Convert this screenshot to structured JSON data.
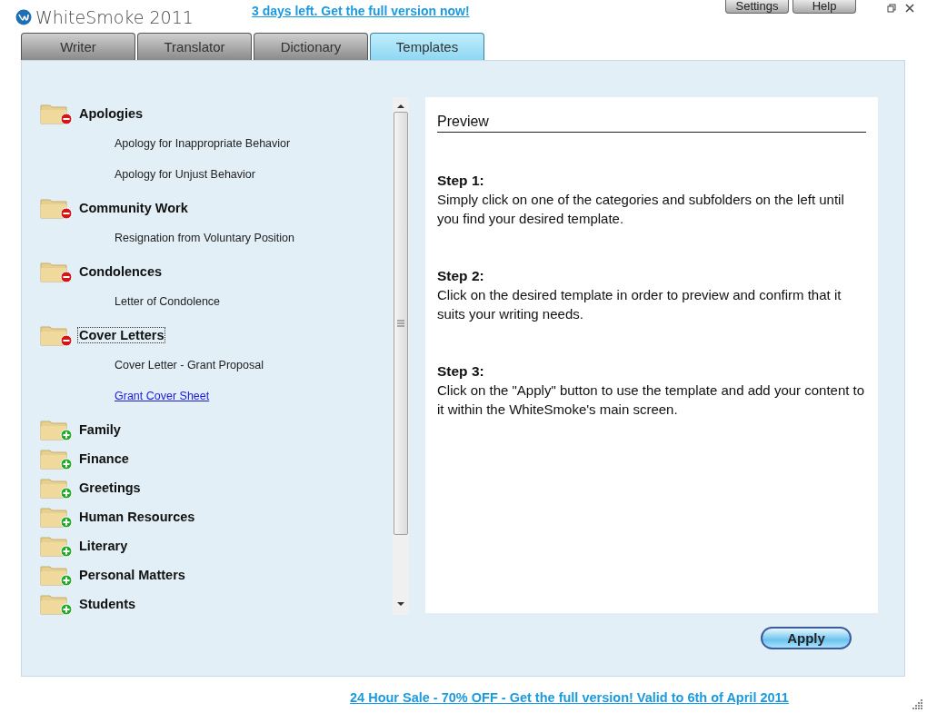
{
  "app": {
    "title": "WhiteSmoke 2011",
    "promo_link": "3 days left. Get the full version now!",
    "buttons": [
      "Settings",
      "Help"
    ]
  },
  "tabs": [
    {
      "label": "Writer",
      "selected": false
    },
    {
      "label": "Translator",
      "selected": false
    },
    {
      "label": "Dictionary",
      "selected": false
    },
    {
      "label": "Templates",
      "selected": true
    }
  ],
  "categories": [
    {
      "label": "Apologies",
      "expanded": true,
      "focused": false,
      "children": [
        {
          "label": "Apology for Inappropriate Behavior",
          "selected": false
        },
        {
          "label": "Apology for Unjust Behavior",
          "selected": false
        }
      ]
    },
    {
      "label": "Community Work",
      "expanded": true,
      "focused": false,
      "children": [
        {
          "label": "Resignation from Voluntary Position",
          "selected": false
        }
      ]
    },
    {
      "label": "Condolences",
      "expanded": true,
      "focused": false,
      "children": [
        {
          "label": "Letter of Condolence",
          "selected": false
        }
      ]
    },
    {
      "label": "Cover Letters",
      "expanded": true,
      "focused": true,
      "children": [
        {
          "label": "Cover Letter - Grant Proposal",
          "selected": false
        },
        {
          "label": "Grant Cover Sheet",
          "selected": true
        }
      ]
    },
    {
      "label": "Family",
      "expanded": false,
      "focused": false
    },
    {
      "label": "Finance",
      "expanded": false,
      "focused": false
    },
    {
      "label": "Greetings",
      "expanded": false,
      "focused": false
    },
    {
      "label": "Human Resources",
      "expanded": false,
      "focused": false
    },
    {
      "label": "Literary",
      "expanded": false,
      "focused": false
    },
    {
      "label": "Personal Matters",
      "expanded": false,
      "focused": false
    },
    {
      "label": "Students",
      "expanded": false,
      "focused": false
    }
  ],
  "preview": {
    "title": "Preview",
    "steps": [
      {
        "heading": "Step 1:",
        "text": "Simply click on one of the categories and subfolders on the left until you find your desired template."
      },
      {
        "heading": "Step 2:",
        "text": "Click on the desired template in order to preview and confirm that it suits your writing needs."
      },
      {
        "heading": "Step 3:",
        "text": "Click on the \"Apply\" button to use the template and add your content to it within the WhiteSmoke's main screen."
      }
    ]
  },
  "apply_button": "Apply",
  "footer_link": "24 Hour Sale - 70% OFF - Get the full version! Valid to 6th of April 2011"
}
